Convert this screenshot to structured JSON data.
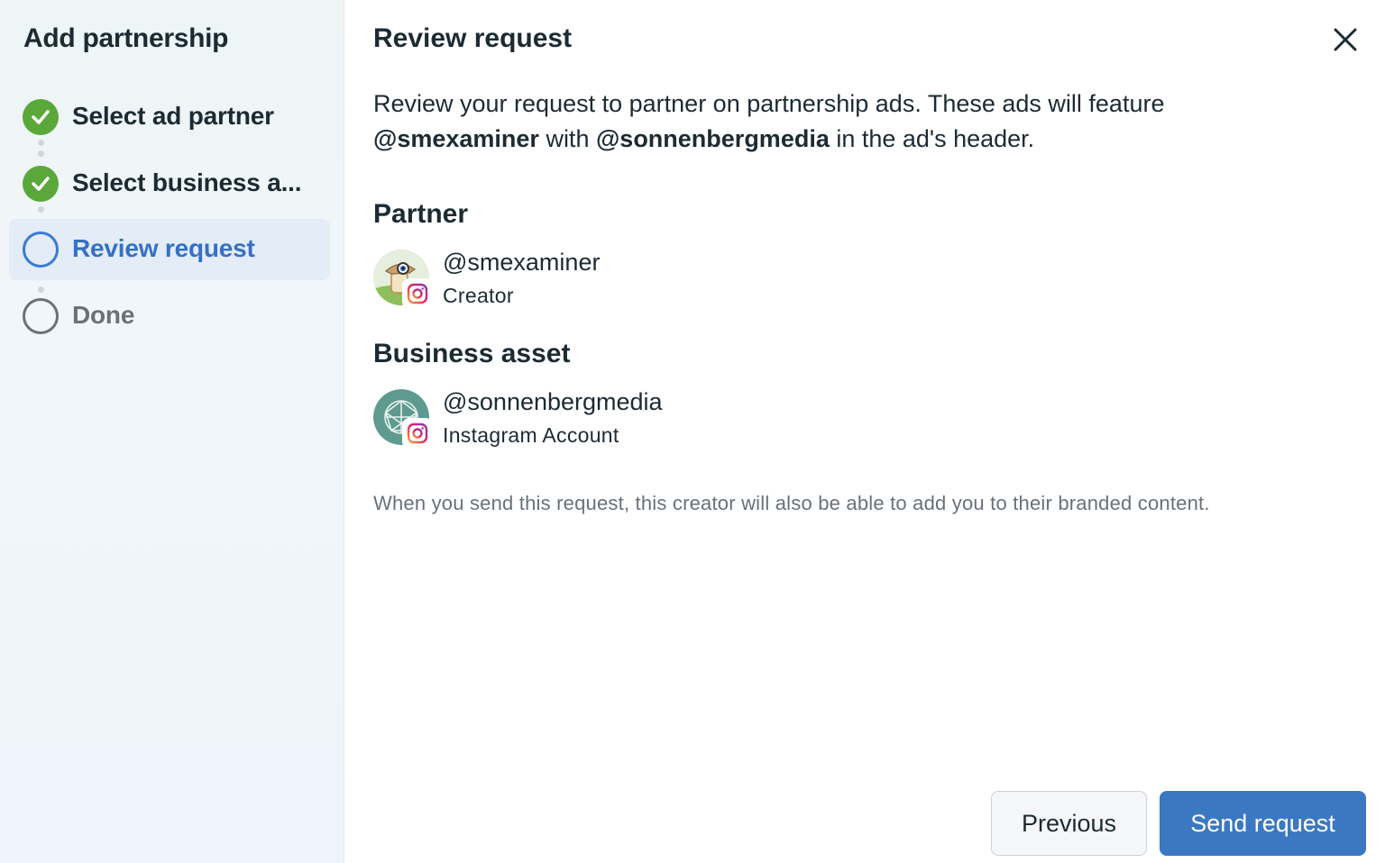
{
  "sidebar": {
    "title": "Add partnership",
    "steps": [
      {
        "label": "Select ad partner",
        "state": "done"
      },
      {
        "label": "Select business a...",
        "state": "done"
      },
      {
        "label": "Review request",
        "state": "current"
      },
      {
        "label": "Done",
        "state": "todo"
      }
    ]
  },
  "main": {
    "title": "Review request",
    "description": {
      "prefix": "Review your request to partner on partnership ads. These ads will feature",
      "partner_handle": "@smexaminer",
      "middle": " with ",
      "asset_handle": "@sonnenbergmedia",
      "suffix": " in the ad's header."
    },
    "partner_section": {
      "title": "Partner",
      "account": {
        "name": "@smexaminer",
        "subtitle": "Creator",
        "avatar_icon": "smexaminer-avatar-icon",
        "badge_icon": "instagram-icon"
      }
    },
    "asset_section": {
      "title": "Business asset",
      "account": {
        "name": "@sonnenbergmedia",
        "subtitle": "Instagram Account",
        "avatar_icon": "sonnenbergmedia-avatar-icon",
        "badge_icon": "instagram-icon"
      }
    },
    "note": "When you send this request, this creator will also be able to add you to their branded content."
  },
  "footer": {
    "previous_label": "Previous",
    "send_label": "Send request"
  },
  "colors": {
    "accent": "#3b78c1",
    "active_step": "#3670c2",
    "done_step": "#5aa83a",
    "text": "#1c2b33",
    "muted": "#68717a"
  }
}
